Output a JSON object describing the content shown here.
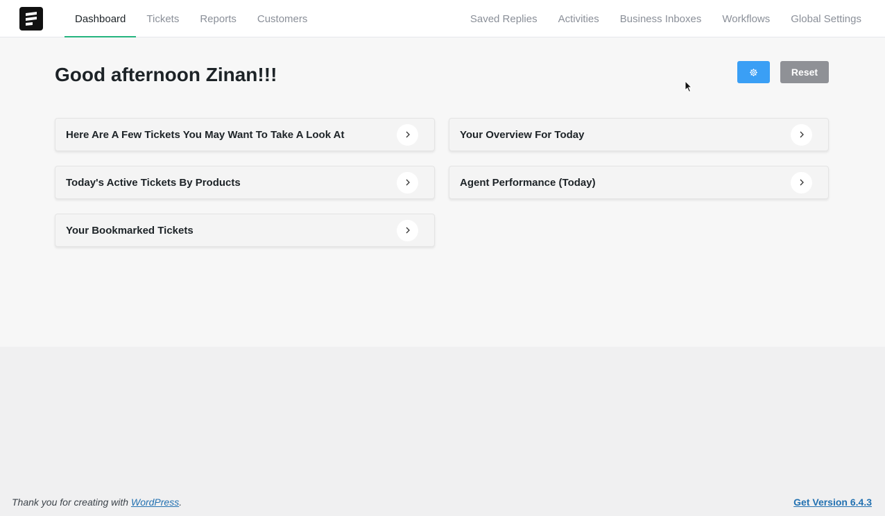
{
  "nav": {
    "left": [
      {
        "label": "Dashboard",
        "active": true
      },
      {
        "label": "Tickets",
        "active": false
      },
      {
        "label": "Reports",
        "active": false
      },
      {
        "label": "Customers",
        "active": false
      }
    ],
    "right": [
      {
        "label": "Saved Replies"
      },
      {
        "label": "Activities"
      },
      {
        "label": "Business Inboxes"
      },
      {
        "label": "Workflows"
      },
      {
        "label": "Global Settings"
      }
    ]
  },
  "greeting": "Good afternoon Zinan!!!",
  "toolbar": {
    "settings_icon": "gear-icon",
    "reset_label": "Reset",
    "gear_color": "#3a9ff5",
    "reset_color": "#8f9196"
  },
  "cards": [
    {
      "title": "Here Are A Few Tickets You May Want To Take A Look At"
    },
    {
      "title": "Your Overview For Today"
    },
    {
      "title": "Today's Active Tickets By Products"
    },
    {
      "title": "Agent Performance (Today)"
    },
    {
      "title": "Your Bookmarked Tickets"
    }
  ],
  "footer": {
    "thanks_prefix": "Thank you for creating with ",
    "wordpress_link": "WordPress",
    "thanks_suffix": ".",
    "version_link": "Get Version 6.4.3"
  },
  "accent_color": "#24b47e"
}
